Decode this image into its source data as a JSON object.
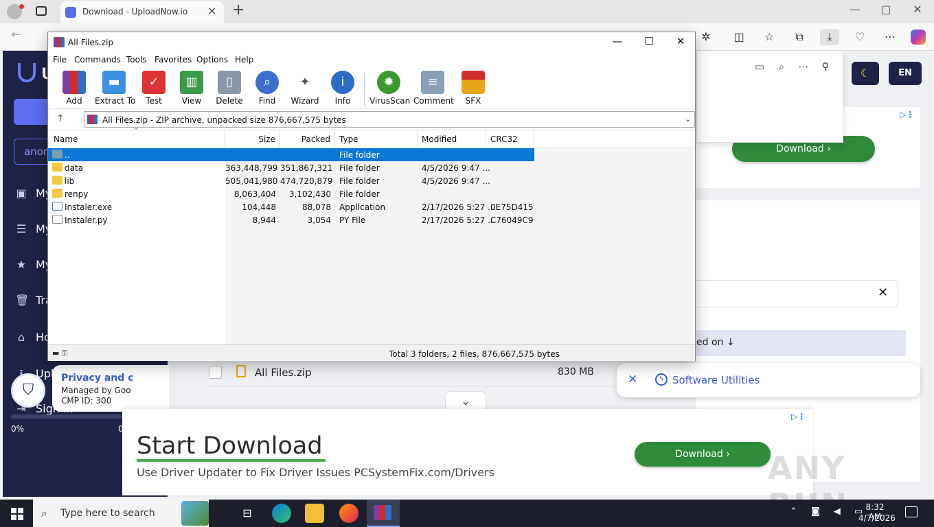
{
  "browser": {
    "tab_title": "Download - UploadNow.io",
    "new_tab": "+",
    "controls": {
      "minimize": "—",
      "restore": "▢",
      "close": "✕"
    }
  },
  "site": {
    "logo_letter": "U",
    "search_value": "anon",
    "sidebar": [
      {
        "label": "My",
        "icon": "upload-icon"
      },
      {
        "label": "My",
        "icon": "list-icon"
      },
      {
        "label": "My",
        "icon": "star-icon"
      },
      {
        "label": "Tra",
        "icon": "trash-icon"
      },
      {
        "label": "Ho",
        "icon": "home-icon"
      },
      {
        "label": "Upload files",
        "icon": "upload-icon"
      },
      {
        "label": "Sign in",
        "icon": "sign-in-icon"
      }
    ],
    "privacy": {
      "title": "Privacy and c",
      "managed": "Managed by Goo",
      "cmp": "CMP ID: 300"
    },
    "progress": {
      "left_pct": "0%",
      "right_pct": "0"
    },
    "theme_icon": "moon-icon",
    "lang": "EN",
    "ad_top_button": "Download",
    "sort_label": "ed on ↓",
    "file": {
      "name": "All Files.zip",
      "size": "830 MB"
    },
    "util_label": "Software Utilities",
    "ad_bottom": {
      "headline": "Start Download",
      "subtext": "Use Driver Updater to Fix Driver Issues PCSystemFix.com/Drivers",
      "button": "Download"
    },
    "watermark": "ANY RUN"
  },
  "winrar": {
    "title": "All Files.zip",
    "menu": [
      "File",
      "Commands",
      "Tools",
      "Favorites",
      "Options",
      "Help"
    ],
    "toolbar": [
      "Add",
      "Extract To",
      "Test",
      "View",
      "Delete",
      "Find",
      "Wizard",
      "Info",
      "VirusScan",
      "Comment",
      "SFX"
    ],
    "address": "All Files.zip - ZIP archive, unpacked size 876,667,575 bytes",
    "columns": [
      "Name",
      "Size",
      "Packed",
      "Type",
      "Modified",
      "CRC32"
    ],
    "rows": [
      {
        "name": "..",
        "size": "",
        "packed": "",
        "type": "File folder",
        "modified": "",
        "crc": ""
      },
      {
        "name": "data",
        "size": "363,448,799",
        "packed": "351,867,321",
        "type": "File folder",
        "modified": "4/5/2026 9:47 ...",
        "crc": ""
      },
      {
        "name": "lib",
        "size": "505,041,980",
        "packed": "474,720,879",
        "type": "File folder",
        "modified": "4/5/2026 9:47 ...",
        "crc": ""
      },
      {
        "name": "renpy",
        "size": "8,063,404",
        "packed": "3,102,430",
        "type": "File folder",
        "modified": "",
        "crc": ""
      },
      {
        "name": "Instaler.exe",
        "size": "104,448",
        "packed": "88,078",
        "type": "Application",
        "modified": "2/17/2026 5:27 ...",
        "crc": "0E75D415"
      },
      {
        "name": "Instaler.py",
        "size": "8,944",
        "packed": "3,054",
        "type": "PY File",
        "modified": "2/17/2026 5:27 ...",
        "crc": "C76049C9"
      }
    ],
    "status": "Total 3 folders, 2 files, 876,667,575 bytes"
  },
  "taskbar": {
    "search_placeholder": "Type here to search",
    "time": "8:32 AM",
    "date": "4/7/2026"
  }
}
